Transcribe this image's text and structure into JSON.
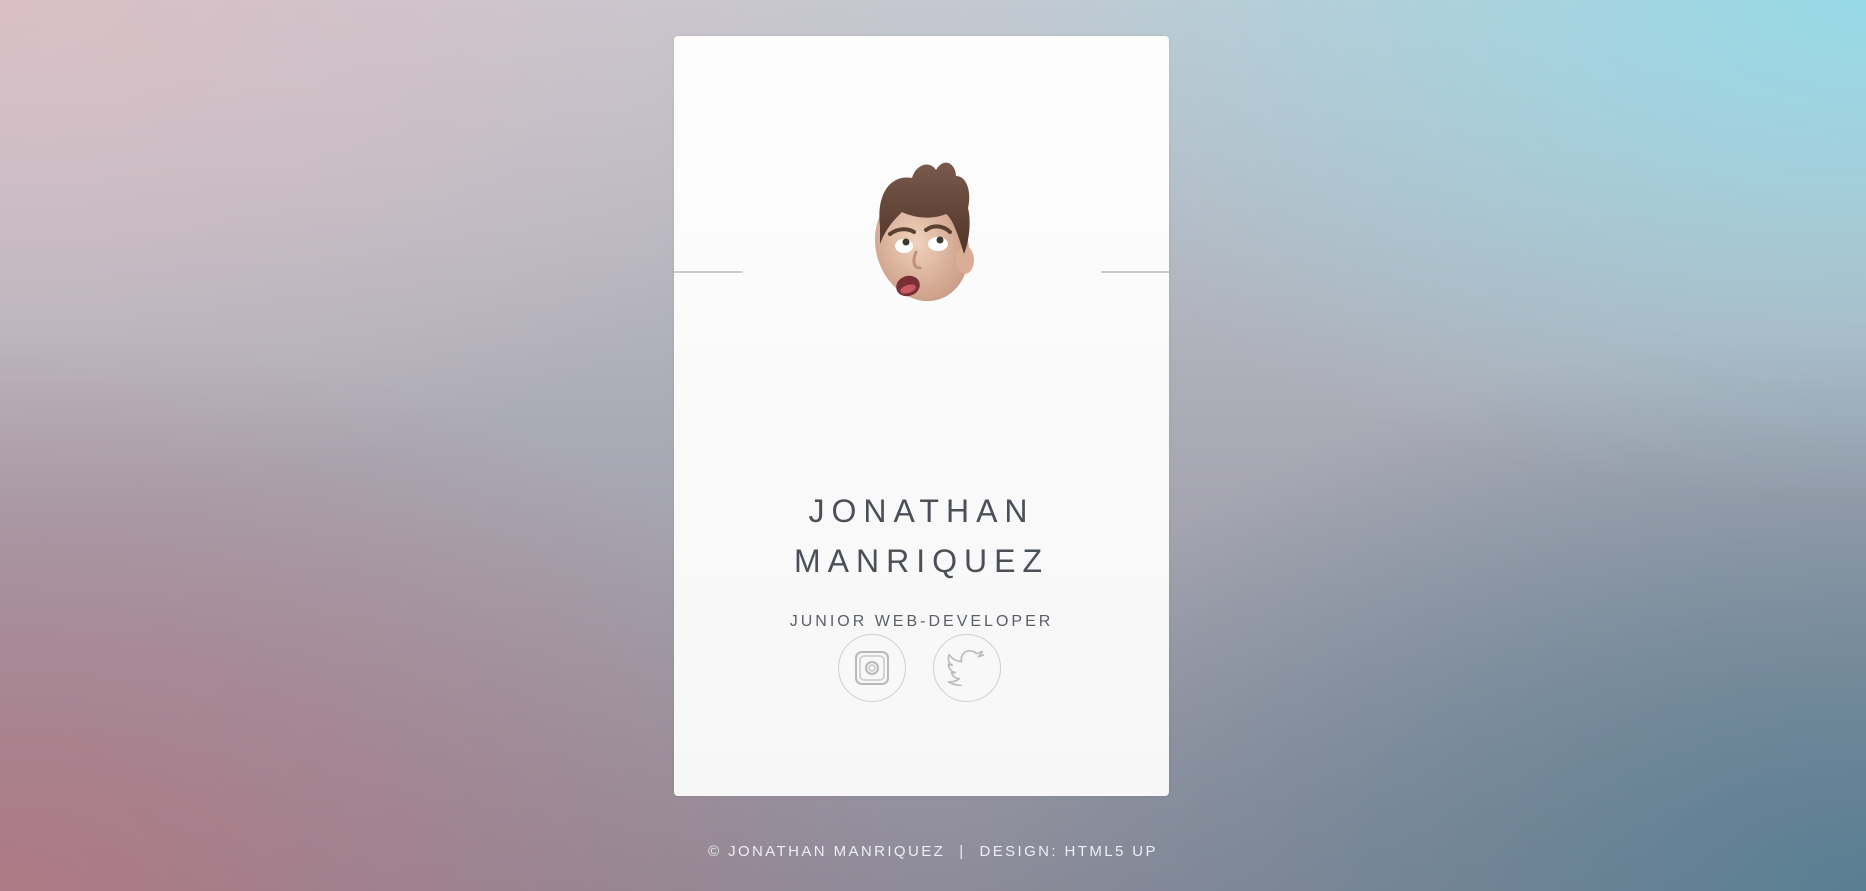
{
  "profile": {
    "name_line1": "JONATHAN",
    "name_line2": "MANRIQUEZ",
    "role": "JUNIOR WEB-DEVELOPER",
    "avatar_icon": "memoji-avatar-icon"
  },
  "social": [
    {
      "name": "Instagram",
      "icon": "instagram-icon"
    },
    {
      "name": "Twitter",
      "icon": "twitter-icon"
    }
  ],
  "footer": {
    "copyright": "© JONATHAN MANRIQUEZ",
    "separator": "|",
    "design": "DESIGN: HTML5 UP"
  },
  "colors": {
    "card": "#fdfdfd",
    "text": "#4b4f57",
    "icon_border": "#cfcfcf"
  }
}
